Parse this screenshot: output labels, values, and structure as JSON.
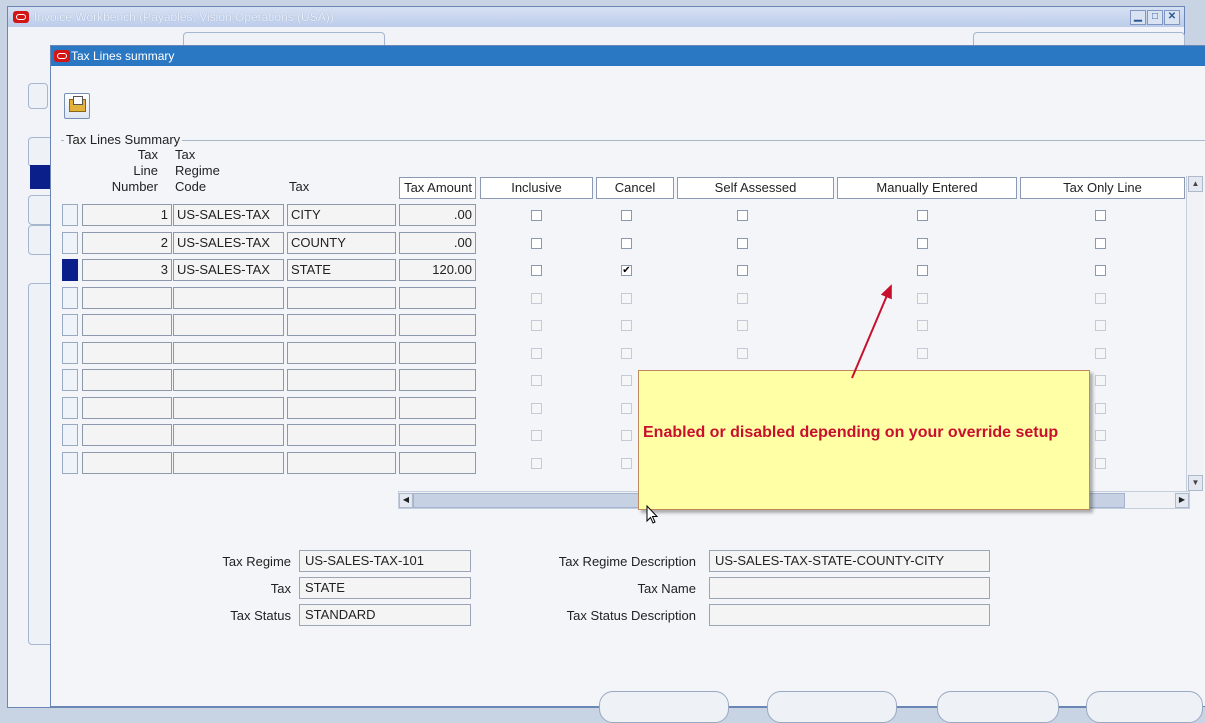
{
  "outer_window": {
    "title": "Invoice Workbench (Payables, Vision Operations (USA))"
  },
  "dialog": {
    "title": "Tax Lines summary"
  },
  "toolbar": {
    "open_icon": "folder-open-icon"
  },
  "group": {
    "label": "Tax Lines Summary"
  },
  "columns": {
    "line_number": [
      "Tax",
      "Line",
      "Number"
    ],
    "regime_code": [
      "Tax",
      "Regime",
      "Code"
    ],
    "tax": "Tax",
    "tax_amount": "Tax Amount",
    "inclusive": "Inclusive",
    "cancel": "Cancel",
    "self_assessed": "Self Assessed",
    "manually_entered": "Manually Entered",
    "tax_only_line": "Tax Only Line"
  },
  "rows": [
    {
      "line": "1",
      "regime": "US-SALES-TAX",
      "tax": "CITY",
      "amount": ".00",
      "inclusive": false,
      "cancel": false,
      "self_assessed": false,
      "manual": false,
      "tax_only": false
    },
    {
      "line": "2",
      "regime": "US-SALES-TAX",
      "tax": "COUNTY",
      "amount": ".00",
      "inclusive": false,
      "cancel": false,
      "self_assessed": false,
      "manual": false,
      "tax_only": false
    },
    {
      "line": "3",
      "regime": "US-SALES-TAX",
      "tax": "STATE",
      "amount": "120.00",
      "inclusive": false,
      "cancel": true,
      "self_assessed": false,
      "manual": false,
      "tax_only": false
    }
  ],
  "selected_row": 3,
  "details": {
    "tax_regime_label": "Tax Regime",
    "tax_regime_value": "US-SALES-TAX-101",
    "tax_label": "Tax",
    "tax_value": "STATE",
    "tax_status_label": "Tax Status",
    "tax_status_value": "STANDARD",
    "regime_desc_label": "Tax Regime Description",
    "regime_desc_value": "US-SALES-TAX-STATE-COUNTY-CITY",
    "tax_name_label": "Tax Name",
    "tax_name_value": "",
    "status_desc_label": "Tax Status Description",
    "status_desc_value": ""
  },
  "callout": {
    "text": "Enabled or disabled depending on your override setup"
  },
  "colors": {
    "title_bar": "#2a78c4",
    "selected_indicator": "#0a1f8a",
    "callout_bg": "#ffffa6",
    "callout_text": "#c8102e"
  }
}
